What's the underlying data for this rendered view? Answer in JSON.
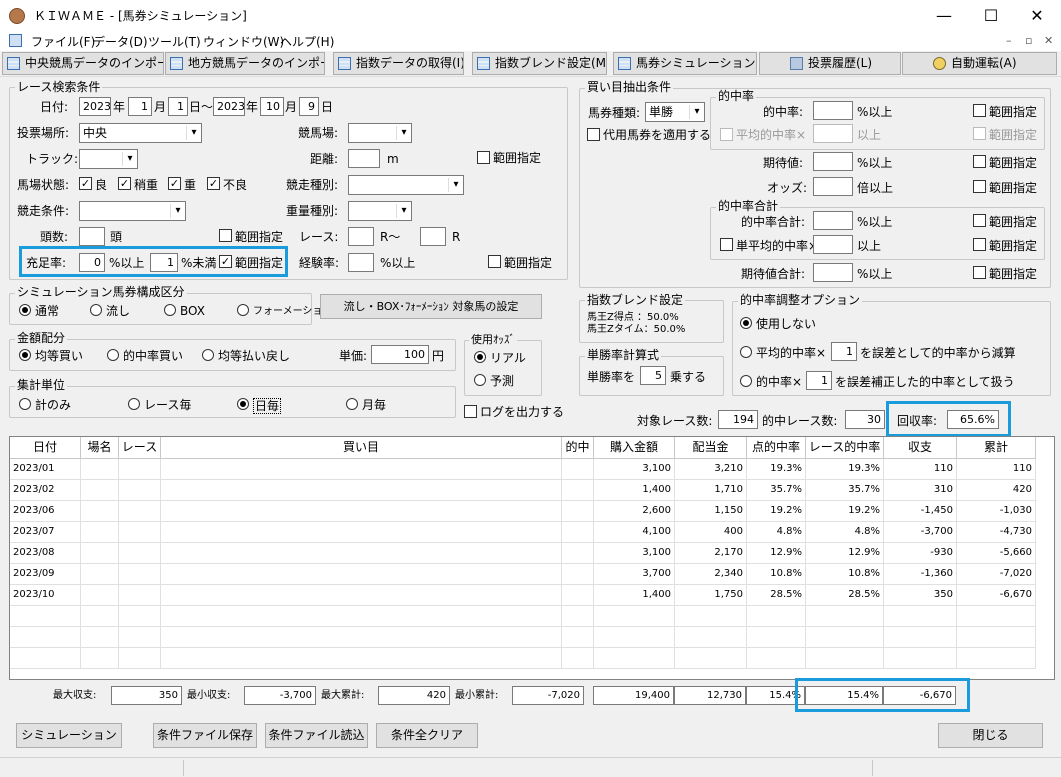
{
  "window": {
    "title": "ＫＩＷＡＭＥ - [馬券シミュレーション]",
    "min": "—",
    "max": "☐",
    "close": "✕"
  },
  "menu": [
    "ファイル(F)",
    "データ(D)",
    "ツール(T)",
    "ウィンドウ(W)",
    "ヘルプ(H)"
  ],
  "mdi": [
    "–",
    "▫",
    "✕"
  ],
  "toolbar": [
    "中央競馬データのインポート(J)",
    "地方競馬データのインポート(N)",
    "指数データの取得(I)",
    "指数ブレンド設定(M)",
    "馬券シミュレーション(B)",
    "投票履歴(L)",
    "自動運転(A)"
  ],
  "race": {
    "legend": "レース検索条件",
    "date_label": "日付:",
    "y1": "2023",
    "m1": "1",
    "d1": "1",
    "y2": "2023",
    "m2": "10",
    "d2": "9",
    "year": "年",
    "month": "月",
    "day": "日",
    "tilde": "日〜",
    "day_end": "日",
    "venue_label": "投票場所:",
    "venue": "中央",
    "track_venue_label": "競馬場:",
    "track_label": "トラック:",
    "distance_label": "距離:",
    "distance_unit": "m",
    "range": "範囲指定",
    "condition_label": "馬場状態:",
    "cond": [
      "良",
      "稍重",
      "重",
      "不良"
    ],
    "race_type_label": "競走種別:",
    "race_cond_label": "競走条件:",
    "weight_label": "重量種別:",
    "heads_label": "頭数:",
    "heads_unit": "頭",
    "race_label": "レース:",
    "race_r1": "R〜",
    "race_r2": "R",
    "fill_label": "充足率:",
    "fill_from": "0",
    "fill_from_unit": "%以上",
    "fill_to": "1",
    "fill_to_unit": "%未満",
    "exp_label": "経験率:",
    "exp_unit": "%以上"
  },
  "buy": {
    "legend": "買い目抽出条件",
    "type_label": "馬券種類:",
    "type": "単勝",
    "substitute": "代用馬券を適用する",
    "hit_legend": "的中率",
    "hit_label": "的中率:",
    "pct_over": "%以上",
    "avg_hit": "平均的中率×",
    "over": "以上",
    "ev_label": "期待値:",
    "odds_label": "オッズ:",
    "odds_unit": "倍以上",
    "total_legend": "的中率合計",
    "hit_total_label": "的中率合計:",
    "single_avg": "単平均的中率×",
    "ev_total_label": "期待値合計:",
    "range": "範囲指定"
  },
  "sim": {
    "legend": "シミュレーション馬券構成区分",
    "opts": [
      "通常",
      "流し",
      "BOX",
      "フォーメーション"
    ],
    "setting_btn": "流し・BOX･ﾌｫｰﾒｰｼｮﾝ 対象馬の設定"
  },
  "blend": {
    "legend": "指数ブレンド設定",
    "line1": "馬王Z得点 ：50.0%",
    "line2": "馬王Zタイム：50.0%"
  },
  "adjust": {
    "legend": "的中率調整オプション",
    "none": "使用しない",
    "opt2a": "平均的中率×",
    "opt2v": "1",
    "opt2b": "を誤差として的中率から減算",
    "opt3a": "的中率×",
    "opt3v": "1",
    "opt3b": "を誤差補正した的中率として扱う"
  },
  "money": {
    "legend": "金額配分",
    "opts": [
      "均等買い",
      "的中率買い",
      "均等払い戻し"
    ],
    "unit_label": "単価:",
    "unit_value": "100",
    "yen": "円"
  },
  "odds": {
    "legend": "使用ｵｯｽﾞ",
    "opts": [
      "リアル",
      "予測"
    ]
  },
  "single": {
    "legend": "単勝率計算式",
    "prefix": "単勝率を",
    "value": "5",
    "suffix": "乗する"
  },
  "agg": {
    "legend": "集計単位",
    "opts": [
      "計のみ",
      "レース毎",
      "日毎",
      "月毎"
    ]
  },
  "log": "ログを出力する",
  "stats": {
    "target_label": "対象レース数:",
    "target": "194",
    "hit_label": "的中レース数:",
    "hit": "30",
    "return_label": "回収率:",
    "return": "65.6%"
  },
  "table": {
    "headers": [
      "日付",
      "場名",
      "レース",
      "買い目",
      "的中",
      "購入金額",
      "配当金",
      "点的中率",
      "レース的中率",
      "収支",
      "累計"
    ],
    "rows": [
      [
        "2023/01",
        "",
        "",
        "",
        "",
        "3,100",
        "3,210",
        "19.3%",
        "19.3%",
        "110",
        "110"
      ],
      [
        "2023/02",
        "",
        "",
        "",
        "",
        "1,400",
        "1,710",
        "35.7%",
        "35.7%",
        "310",
        "420"
      ],
      [
        "2023/06",
        "",
        "",
        "",
        "",
        "2,600",
        "1,150",
        "19.2%",
        "19.2%",
        "-1,450",
        "-1,030"
      ],
      [
        "2023/07",
        "",
        "",
        "",
        "",
        "4,100",
        "400",
        "4.8%",
        "4.8%",
        "-3,700",
        "-4,730"
      ],
      [
        "2023/08",
        "",
        "",
        "",
        "",
        "3,100",
        "2,170",
        "12.9%",
        "12.9%",
        "-930",
        "-5,660"
      ],
      [
        "2023/09",
        "",
        "",
        "",
        "",
        "3,700",
        "2,340",
        "10.8%",
        "10.8%",
        "-1,360",
        "-7,020"
      ],
      [
        "2023/10",
        "",
        "",
        "",
        "",
        "1,400",
        "1,750",
        "28.5%",
        "28.5%",
        "350",
        "-6,670"
      ]
    ]
  },
  "summary": {
    "max_label": "最大収支:",
    "max": "350",
    "min_label": "最小収支:",
    "min": "-3,700",
    "maxcum_label": "最大累計:",
    "maxcum": "420",
    "mincum_label": "最小累計:",
    "mincum": "-7,020",
    "purchase": "19,400",
    "payout": "12,730",
    "point_hit": "15.4%",
    "race_hit": "15.4%",
    "total": "-6,670"
  },
  "buttons": {
    "simulate": "シミュレーション",
    "save": "条件ファイル保存",
    "load": "条件ファイル読込",
    "clear": "条件全クリア",
    "close": "閉じる"
  }
}
